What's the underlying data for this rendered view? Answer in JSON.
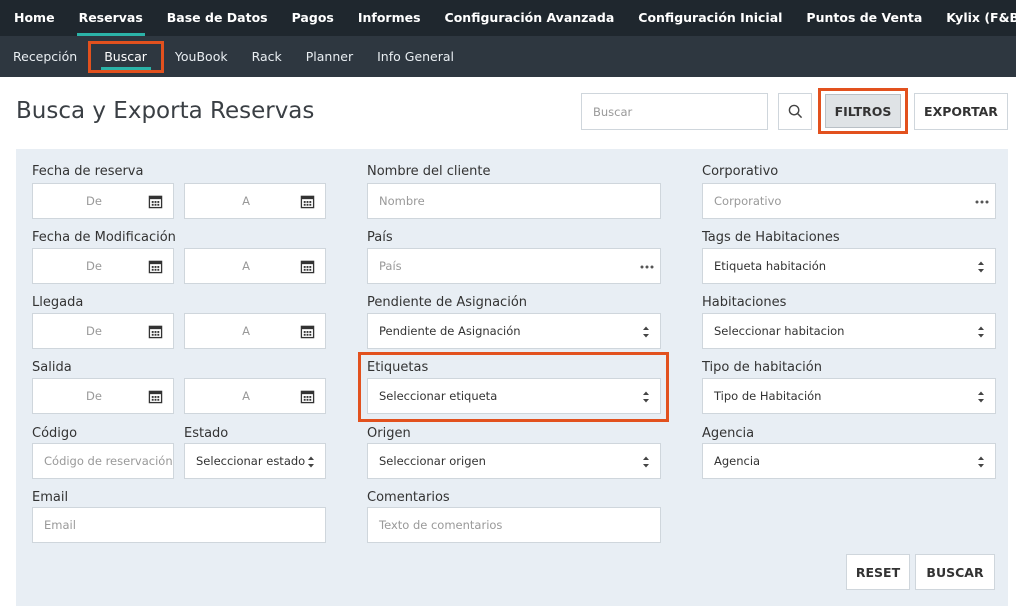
{
  "topnav": {
    "items": [
      "Home",
      "Reservas",
      "Base de Datos",
      "Pagos",
      "Informes",
      "Configuración Avanzada",
      "Configuración Inicial",
      "Puntos de Venta",
      "Kylix (F&B)"
    ],
    "active_index": 1
  },
  "subnav": {
    "items": [
      "Recepción",
      "Buscar",
      "YouBook",
      "Rack",
      "Planner",
      "Info General"
    ],
    "active_index": 1
  },
  "header": {
    "title": "Busca y Exporta Reservas",
    "search_placeholder": "Buscar",
    "filtros_label": "FILTROS",
    "exportar_label": "EXPORTAR"
  },
  "form": {
    "fecha_reserva": {
      "label": "Fecha de reserva",
      "from": "De",
      "to": "A"
    },
    "fecha_modificacion": {
      "label": "Fecha de Modificación",
      "from": "De",
      "to": "A"
    },
    "llegada": {
      "label": "Llegada",
      "from": "De",
      "to": "A"
    },
    "salida": {
      "label": "Salida",
      "from": "De",
      "to": "A"
    },
    "codigo": {
      "label": "Código",
      "placeholder": "Código de reservación"
    },
    "estado": {
      "label": "Estado",
      "value": "Seleccionar estado"
    },
    "email": {
      "label": "Email",
      "placeholder": "Email"
    },
    "nombre_cliente": {
      "label": "Nombre del cliente",
      "placeholder": "Nombre"
    },
    "pais": {
      "label": "País",
      "placeholder": "País"
    },
    "pendiente": {
      "label": "Pendiente de Asignación",
      "value": "Pendiente de Asignación"
    },
    "etiquetas": {
      "label": "Etiquetas",
      "value": "Seleccionar etiqueta"
    },
    "origen": {
      "label": "Origen",
      "value": "Seleccionar origen"
    },
    "comentarios": {
      "label": "Comentarios",
      "placeholder": "Texto de comentarios"
    },
    "corporativo": {
      "label": "Corporativo",
      "placeholder": "Corporativo"
    },
    "tags_habitaciones": {
      "label": "Tags de Habitaciones",
      "value": "Etiqueta habitación"
    },
    "habitaciones": {
      "label": "Habitaciones",
      "value": "Seleccionar habitacion"
    },
    "tipo_habitacion": {
      "label": "Tipo de habitación",
      "value": "Tipo de Habitación"
    },
    "agencia": {
      "label": "Agencia",
      "value": "Agencia"
    }
  },
  "actions": {
    "reset_label": "RESET",
    "buscar_label": "BUSCAR"
  },
  "colors": {
    "topnav_bg": "#1f272e",
    "subnav_bg": "#2e3740",
    "accent": "#2bb3a8",
    "highlight": "#e2511e",
    "panel_bg": "#e8eef4"
  },
  "icons": {
    "search": "search-icon",
    "calendar": "calendar-icon",
    "caret": "select-caret-icon",
    "more": "more-dots-icon"
  }
}
